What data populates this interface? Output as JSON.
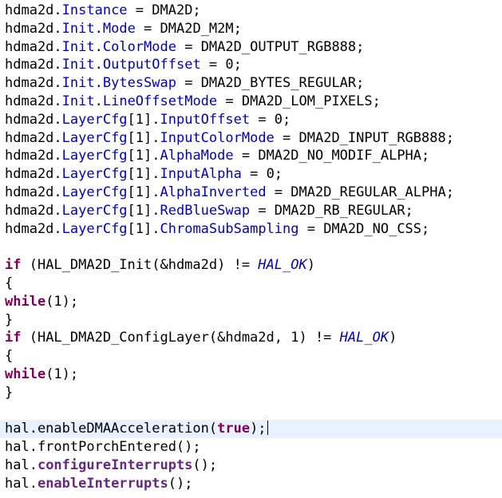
{
  "code": {
    "lines": [
      [
        [
          "hdma2d.",
          "plain"
        ],
        [
          "Instance",
          "field"
        ],
        [
          " = DMA2D;",
          "plain"
        ]
      ],
      [
        [
          "hdma2d.",
          "plain"
        ],
        [
          "Init",
          "field"
        ],
        [
          ".",
          "plain"
        ],
        [
          "Mode",
          "field"
        ],
        [
          " = DMA2D_M2M;",
          "plain"
        ]
      ],
      [
        [
          "hdma2d.",
          "plain"
        ],
        [
          "Init",
          "field"
        ],
        [
          ".",
          "plain"
        ],
        [
          "ColorMode",
          "field"
        ],
        [
          " = DMA2D_OUTPUT_RGB888;",
          "plain"
        ]
      ],
      [
        [
          "hdma2d.",
          "plain"
        ],
        [
          "Init",
          "field"
        ],
        [
          ".",
          "plain"
        ],
        [
          "OutputOffset",
          "field"
        ],
        [
          " = 0;",
          "plain"
        ]
      ],
      [
        [
          "hdma2d.",
          "plain"
        ],
        [
          "Init",
          "field"
        ],
        [
          ".",
          "plain"
        ],
        [
          "BytesSwap",
          "field"
        ],
        [
          " = DMA2D_BYTES_REGULAR;",
          "plain"
        ]
      ],
      [
        [
          "hdma2d.",
          "plain"
        ],
        [
          "Init",
          "field"
        ],
        [
          ".",
          "plain"
        ],
        [
          "LineOffsetMode",
          "field"
        ],
        [
          " = DMA2D_LOM_PIXELS;",
          "plain"
        ]
      ],
      [
        [
          "hdma2d.",
          "plain"
        ],
        [
          "LayerCfg",
          "field"
        ],
        [
          "[1].",
          "plain"
        ],
        [
          "InputOffset",
          "field"
        ],
        [
          " = 0;",
          "plain"
        ]
      ],
      [
        [
          "hdma2d.",
          "plain"
        ],
        [
          "LayerCfg",
          "field"
        ],
        [
          "[1].",
          "plain"
        ],
        [
          "InputColorMode",
          "field"
        ],
        [
          " = DMA2D_INPUT_RGB888;",
          "plain"
        ]
      ],
      [
        [
          "hdma2d.",
          "plain"
        ],
        [
          "LayerCfg",
          "field"
        ],
        [
          "[1].",
          "plain"
        ],
        [
          "AlphaMode",
          "field"
        ],
        [
          " = DMA2D_NO_MODIF_ALPHA;",
          "plain"
        ]
      ],
      [
        [
          "hdma2d.",
          "plain"
        ],
        [
          "LayerCfg",
          "field"
        ],
        [
          "[1].",
          "plain"
        ],
        [
          "InputAlpha",
          "field"
        ],
        [
          " = 0;",
          "plain"
        ]
      ],
      [
        [
          "hdma2d.",
          "plain"
        ],
        [
          "LayerCfg",
          "field"
        ],
        [
          "[1].",
          "plain"
        ],
        [
          "AlphaInverted",
          "field"
        ],
        [
          " = DMA2D_REGULAR_ALPHA;",
          "plain"
        ]
      ],
      [
        [
          "hdma2d.",
          "plain"
        ],
        [
          "LayerCfg",
          "field"
        ],
        [
          "[1].",
          "plain"
        ],
        [
          "RedBlueSwap",
          "field"
        ],
        [
          " = DMA2D_RB_REGULAR;",
          "plain"
        ]
      ],
      [
        [
          "hdma2d.",
          "plain"
        ],
        [
          "LayerCfg",
          "field"
        ],
        [
          "[1].",
          "plain"
        ],
        [
          "ChromaSubSampling",
          "field"
        ],
        [
          " = DMA2D_NO_CSS;",
          "plain"
        ]
      ],
      [],
      [
        [
          "if",
          "kw"
        ],
        [
          " (HAL_DMA2D_Init(&hdma2d) != ",
          "plain"
        ],
        [
          "HAL_OK",
          "const"
        ],
        [
          ")",
          "plain"
        ]
      ],
      [
        [
          "{",
          "plain"
        ]
      ],
      [
        [
          "while",
          "kw"
        ],
        [
          "(1);",
          "plain"
        ]
      ],
      [
        [
          "}",
          "plain"
        ]
      ],
      [
        [
          "if",
          "kw"
        ],
        [
          " (HAL_DMA2D_ConfigLayer(&hdma2d, 1) != ",
          "plain"
        ],
        [
          "HAL_OK",
          "const"
        ],
        [
          ")",
          "plain"
        ]
      ],
      [
        [
          "{",
          "plain"
        ]
      ],
      [
        [
          "while",
          "kw"
        ],
        [
          "(1);",
          "plain"
        ]
      ],
      [
        [
          "}",
          "plain"
        ]
      ],
      [],
      [
        [
          "hal.enableDMAAcceleration(",
          "plain"
        ],
        [
          "true",
          "kw"
        ],
        [
          ");",
          "plain"
        ]
      ],
      [
        [
          "hal.frontPorchEntered();",
          "plain"
        ]
      ],
      [
        [
          "hal.",
          "plain"
        ],
        [
          "configureInterrupts",
          "method"
        ],
        [
          "();",
          "plain"
        ]
      ],
      [
        [
          "hal.",
          "plain"
        ],
        [
          "enableInterrupts",
          "method"
        ],
        [
          "();",
          "plain"
        ]
      ]
    ],
    "current_line": 23
  },
  "colors": {
    "background": "#ffffff",
    "text": "#000000",
    "field": "#0000c0",
    "keyword": "#7f0055",
    "constant": "#0000c0",
    "method": "#642880",
    "current_line_highlight": "#e8f2fe"
  }
}
